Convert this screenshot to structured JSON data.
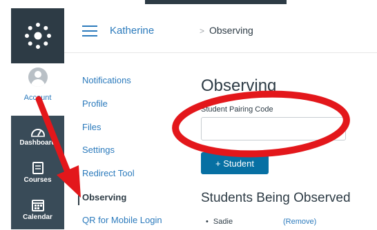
{
  "global_nav": {
    "account_label": "Account",
    "items": [
      {
        "label": "Dashboard",
        "icon": "dashboard-icon"
      },
      {
        "label": "Courses",
        "icon": "courses-icon"
      },
      {
        "label": "Calendar",
        "icon": "calendar-icon"
      }
    ]
  },
  "header": {
    "user_name": "Katherine",
    "separator": ">",
    "current_page": "Observing"
  },
  "account_nav": {
    "items": [
      {
        "label": "Notifications"
      },
      {
        "label": "Profile"
      },
      {
        "label": "Files"
      },
      {
        "label": "Settings"
      },
      {
        "label": "Redirect Tool"
      },
      {
        "label": "Observing",
        "active": true
      },
      {
        "label": "QR for Mobile Login"
      }
    ]
  },
  "main": {
    "title": "Observing",
    "pairing_code_label": "Student Pairing Code",
    "pairing_code_value": "",
    "add_student_label": "+ Student",
    "observed_heading": "Students Being Observed",
    "students": [
      {
        "bullet": "•",
        "name": "Sadie",
        "remove_label": "(Remove)"
      }
    ]
  },
  "colors": {
    "nav_dark": "#394b58",
    "nav_darker": "#2d3b45",
    "link_blue": "#2b7abc",
    "button_blue": "#0770a3",
    "annotation_red": "#e3171b"
  }
}
